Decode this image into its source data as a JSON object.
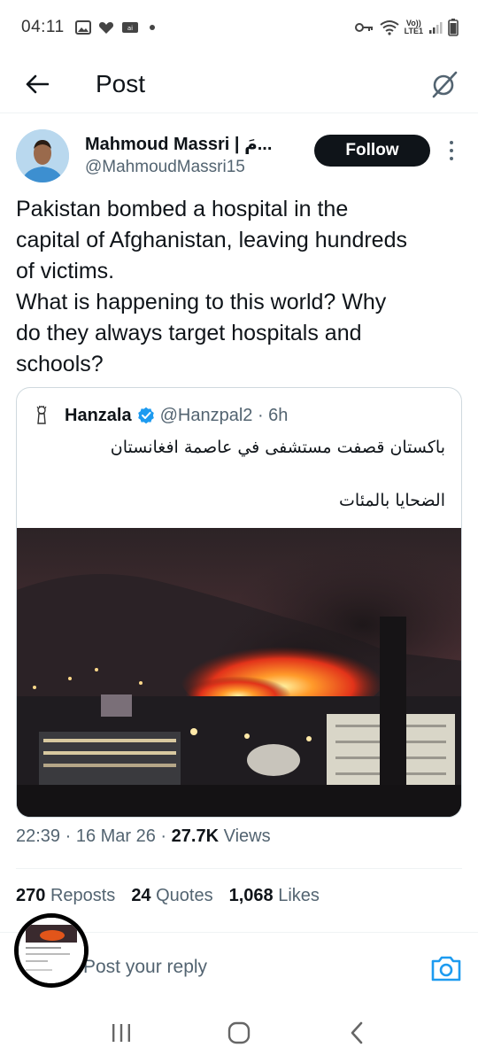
{
  "status_bar": {
    "time": "04:11",
    "network_label_top": "Vo))",
    "network_label_bottom": "LTE1"
  },
  "header": {
    "title": "Post",
    "back_icon": "arrow-left-icon",
    "grok_icon": "grok-icon"
  },
  "author": {
    "name": "Mahmoud Massri | مَ...",
    "handle": "@MahmoudMassri15",
    "follow_label": "Follow"
  },
  "tweet": {
    "text": "Pakistan bombed a hospital in the\ncapital of Afghanistan, leaving hundreds\nof victims.\nWhat is happening to this world? Why\ndo they always target hospitals and\nschools?"
  },
  "quote": {
    "name": "Hanzala",
    "handle": "@Hanzpal2 · 6h",
    "text_line1": "باكستان قصفت مستشفى في عاصمة افغانستان",
    "text_line2": "الضحايا بالمئات"
  },
  "meta": {
    "time": "22:39 · 16 Mar 26 · ",
    "views_count": "27.7K",
    "views_label": " Views"
  },
  "stats": {
    "reposts_count": "270",
    "reposts_label": "Reposts",
    "quotes_count": "24",
    "quotes_label": "Quotes",
    "likes_count": "1,068",
    "likes_label": "Likes"
  },
  "reply": {
    "placeholder": "Post your reply"
  },
  "colors": {
    "text_primary": "#0f1419",
    "text_secondary": "#536471",
    "accent": "#1d9bf0",
    "button_dark": "#0f1419",
    "border": "#cfd9de"
  }
}
